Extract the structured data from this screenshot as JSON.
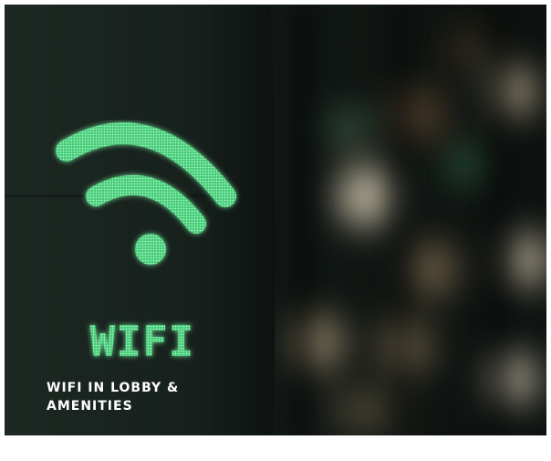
{
  "photo": {
    "subject": "wifi-sign-icon",
    "sign_text": "WIFI",
    "glow_color": "#5ee89a",
    "caption": "WIFI IN LOBBY & AMENITIES"
  }
}
